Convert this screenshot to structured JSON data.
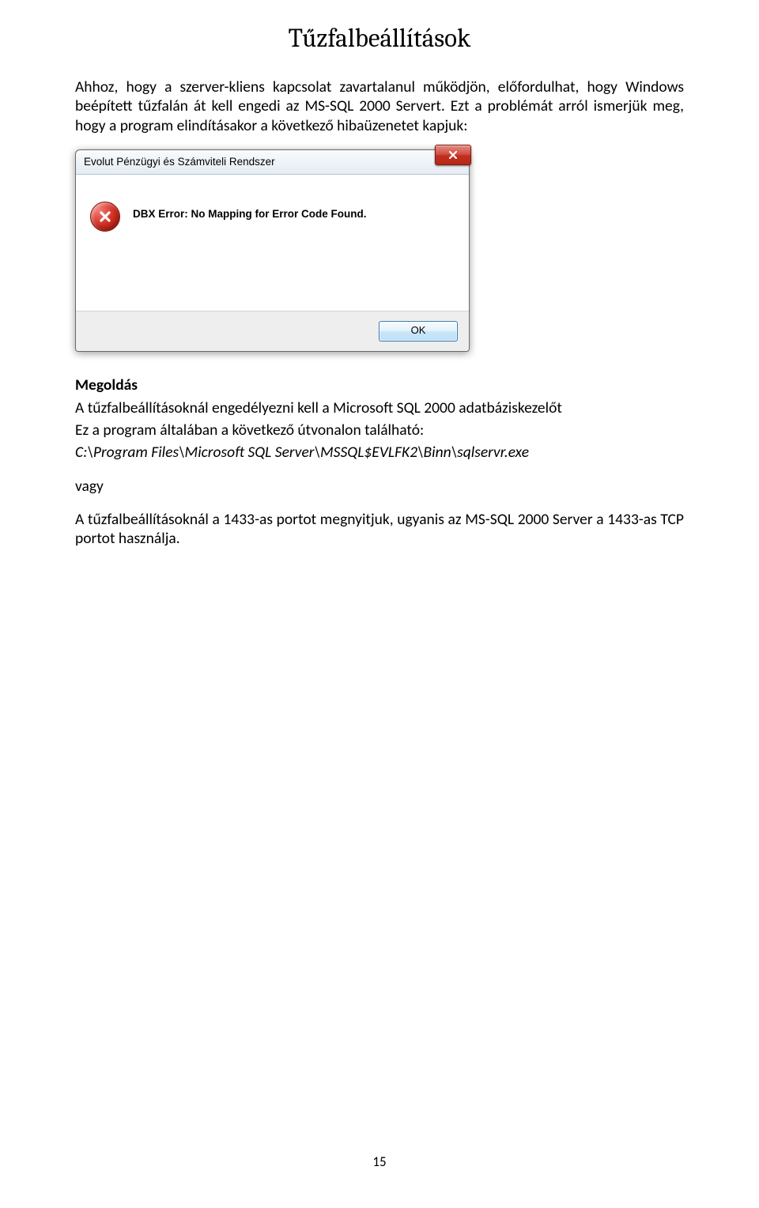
{
  "title": "Tűzfalbeállítások",
  "intro": "Ahhoz, hogy a szerver-kliens kapcsolat zavartalanul működjön, előfordulhat, hogy Windows beépített tűzfalán át kell engedi az MS-SQL 2000 Servert. Ezt a problémát arról ismerjük meg, hogy a program elindításakor a következő hibaüzenetet kapjuk:",
  "dialog": {
    "title": "Evolut Pénzügyi és Számviteli Rendszer",
    "message": "DBX Error: No Mapping for Error Code Found.",
    "ok_label": "OK"
  },
  "solution_heading": "Megoldás",
  "solution_line1": "A tűzfalbeállításoknál engedélyezni kell a Microsoft SQL 2000 adatbáziskezelőt",
  "solution_line2": "Ez a program általában a következő útvonalon található:",
  "solution_path": "C:\\Program Files\\Microsoft SQL Server\\MSSQL$EVLFK2\\Binn\\sqlservr.exe",
  "vagy": "vagy",
  "solution_port": "A tűzfalbeállításoknál a 1433-as portot megnyitjuk, ugyanis az MS-SQL 2000 Server a 1433-as TCP  portot használja.",
  "page_number": "15"
}
